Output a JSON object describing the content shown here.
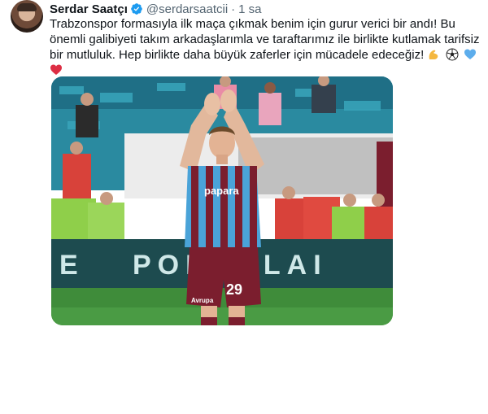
{
  "tweet": {
    "author_name": "Serdar Saatçı",
    "handle": "@serdarsaatcii",
    "separator": "·",
    "time": "1 sa",
    "text": "Trabzonspor formasıyla ilk maça çıkmak benim için gurur verici bir andı! Bu önemli galibiyeti takım arkadaşlarımla ve taraftarımız ile birlikte kutlamak tarifsiz bir mutluluk. Hep birlikte daha büyük zaferler için mücadele edeceğiz!",
    "emojis": [
      "flexed-biceps-emoji",
      "soccer-ball-emoji",
      "blue-heart-emoji",
      "red-heart-emoji"
    ],
    "media": {
      "banner_text": "PORCELAI",
      "banner_text_left": "E",
      "jersey_sponsor": "papara",
      "shorts_number": "29",
      "shorts_sponsor": "Avrupa"
    }
  },
  "colors": {
    "verified": "#1d9bf0",
    "jersey_claret": "#7b1e2e",
    "jersey_blue": "#4aa3d8",
    "pitch": "#3f8c3a"
  }
}
